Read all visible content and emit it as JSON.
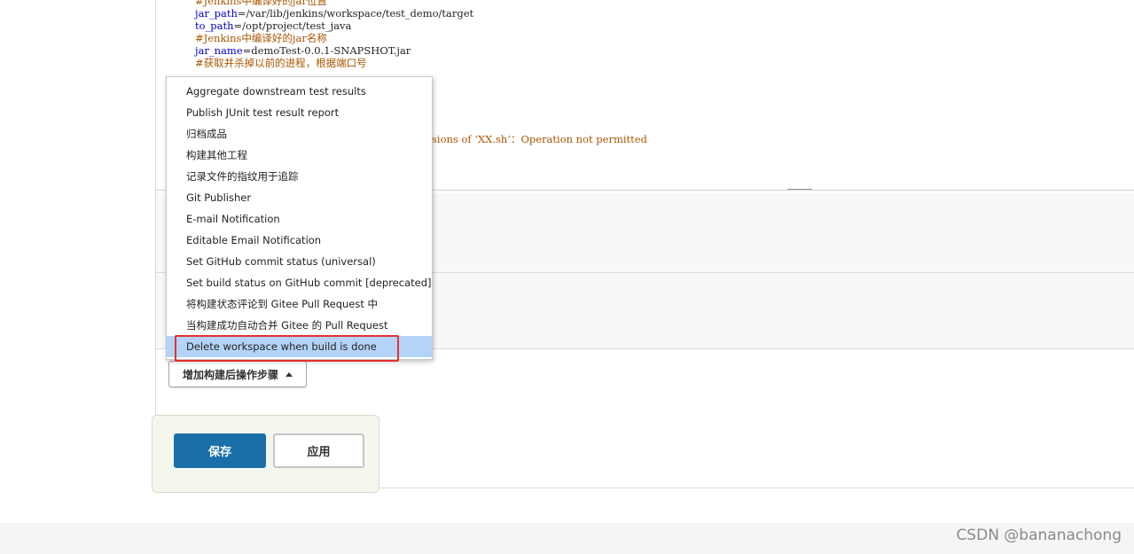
{
  "editor": {
    "lines": [
      {
        "kind": "comment",
        "text": "#Jenkins中编译好的jar位置"
      },
      {
        "kind": "assign",
        "name": "jar_path",
        "value": "=/var/lib/jenkins/workspace/test_demo/target"
      },
      {
        "kind": "assign",
        "name": "to_path",
        "value": "=/opt/project/test_java"
      },
      {
        "kind": "comment",
        "text": "#Jenkins中编译好的jar名称"
      },
      {
        "kind": "assign",
        "name": "jar_name",
        "value": "=demoTest-0.0.1-SNAPSHOT.jar"
      },
      {
        "kind": "comment",
        "text": "#获取并杀掉以前的进程，根据端口号"
      }
    ],
    "error_fragment": "sions of ‘XX.sh’：Operation not permitted"
  },
  "menu": {
    "items": [
      "Aggregate downstream test results",
      "Publish JUnit test result report",
      "归档成品",
      "构建其他工程",
      "记录文件的指纹用于追踪",
      "Git Publisher",
      "E-mail Notification",
      "Editable Email Notification",
      "Set GitHub commit status (universal)",
      "Set build status on GitHub commit [deprecated]",
      "将构建状态评论到 Gitee Pull Request 中",
      "当构建成功自动合并 Gitee 的 Pull Request",
      "Delete workspace when build is done"
    ],
    "active_index": 12
  },
  "add_step_button": "增加构建后操作步骤",
  "save_button": "保存",
  "apply_button": "应用",
  "watermark": "CSDN @bananachong",
  "colors": {
    "save_bg": "#1a6fa8",
    "highlight_border": "#e53030",
    "active_item_bg": "#b3d4f7"
  }
}
